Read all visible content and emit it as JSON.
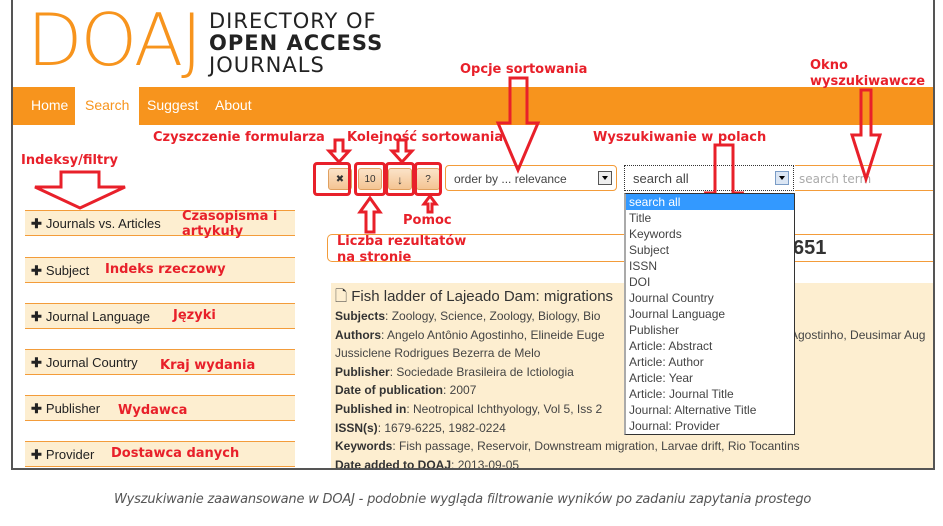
{
  "logo": {
    "mark": "DOAJ",
    "line1": "DIRECTORY OF",
    "line2": "OPEN ACCESS",
    "line3": "JOURNALS"
  },
  "nav": {
    "items": [
      {
        "label": "Home",
        "active": false
      },
      {
        "label": "Search",
        "active": true
      },
      {
        "label": "Suggest",
        "active": false
      },
      {
        "label": "About",
        "active": false
      }
    ]
  },
  "facets": [
    {
      "label": "Journals vs. Articles",
      "annotation": "Czasopisma i artykuły"
    },
    {
      "label": "Subject",
      "annotation": "Indeks rzeczowy"
    },
    {
      "label": "Journal Language",
      "annotation": "Języki"
    },
    {
      "label": "Journal Country",
      "annotation": "Kraj wydania"
    },
    {
      "label": "Publisher",
      "annotation": "Wydawca"
    },
    {
      "label": "Provider",
      "annotation": "Dostawca danych"
    }
  ],
  "toolbar": {
    "clear_icon": "✖",
    "page_size": "10",
    "sort_direction_icon": "↓",
    "help_label": "?",
    "order_by_value": "order by ... relevance",
    "search_field_value": "search all",
    "search_term_placeholder": "search term"
  },
  "search_field_options": [
    "search all",
    "Title",
    "Keywords",
    "Subject",
    "ISSN",
    "DOI",
    "Journal Country",
    "Journal Language",
    "Publisher",
    "Article: Abstract",
    "Article: Author",
    "Article: Year",
    "Article: Journal Title",
    "Journal: Alternative Title",
    "Journal: Provider"
  ],
  "results": {
    "count_visible": "651",
    "item": {
      "title": "Fish ladder of Lajeado Dam: migrations",
      "fields": [
        {
          "label": "Subjects",
          "value": "Zoology, Science, Zoology, Biology, Bio"
        },
        {
          "label": "Authors",
          "value": "Angelo Antônio Agostinho, Elineide Euge",
          "tail": "Agostinho, Deusimar Aug"
        },
        {
          "label": "",
          "value": "Jussiclene Rodrigues Bezerra de Melo"
        },
        {
          "label": "Publisher",
          "value": "Sociedade Brasileira de Ictiologia"
        },
        {
          "label": "Date of publication",
          "value": "2007"
        },
        {
          "label": "Published in",
          "value": "Neotropical Ichthyology, Vol 5, Iss 2"
        },
        {
          "label": "ISSN(s)",
          "value": "1679-6225, 1982-0224"
        },
        {
          "label": "Keywords",
          "value": "Fish passage, Reservoir, Downstream migration, Larvae drift, Rio Tocantins"
        },
        {
          "label": "Date added to DOAJ",
          "value": "2013-09-05"
        }
      ]
    }
  },
  "annotations": {
    "filters": "Indeksy/filtry",
    "clear_form": "Czyszczenie formularza",
    "sort_order": "Kolejność sortowania",
    "sort_options": "Opcje sortowania",
    "field_search": "Wyszukiwanie w polach",
    "search_window_1": "Okno",
    "search_window_2": "wyszukiwawcze",
    "help": "Pomoc",
    "results_per_page_1": "Liczba rezultatów",
    "results_per_page_2": "na stronie"
  },
  "caption": "Wyszukiwanie zaawansowane w DOAJ - podobnie wygląda filtrowanie wyników po zadaniu zapytania prostego",
  "colors": {
    "brand_orange": "#f7941d",
    "facet_bg": "#fdeed0",
    "annotation_red": "#e8202a",
    "selected_option": "#3399ff"
  }
}
